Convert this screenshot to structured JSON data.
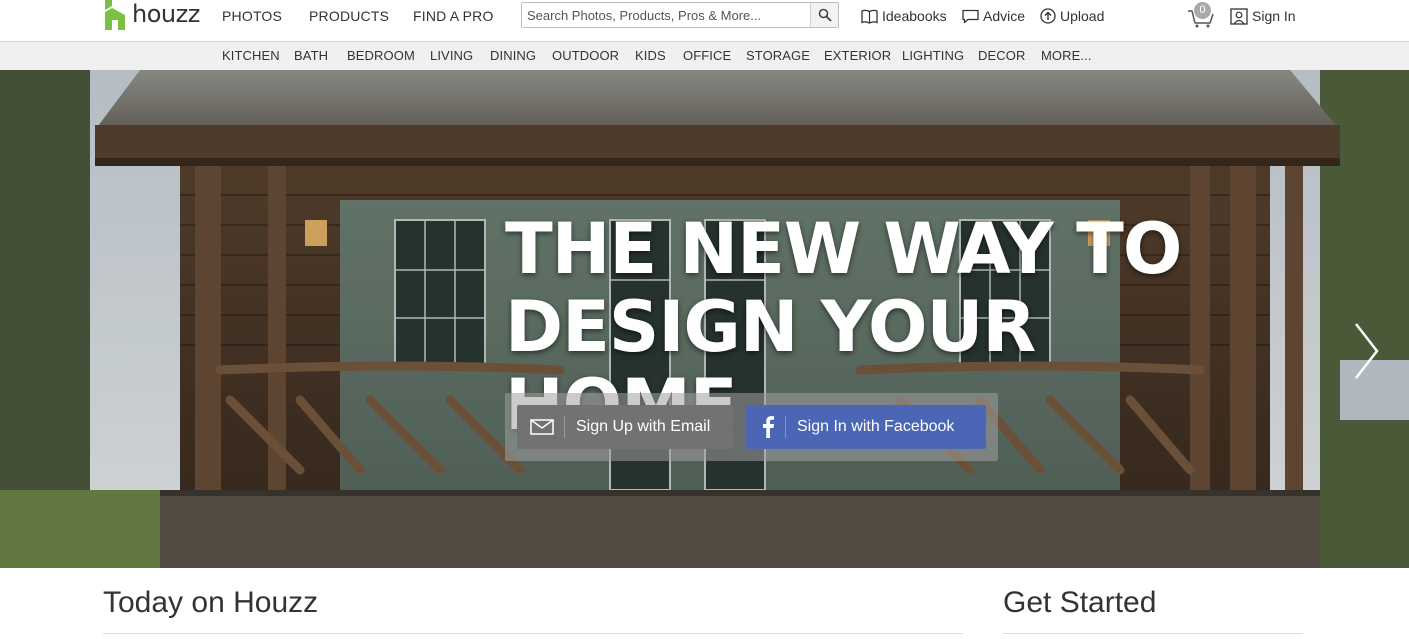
{
  "brand": {
    "name": "houzz",
    "color": "#7ac142"
  },
  "main_nav": [
    {
      "label": "PHOTOS"
    },
    {
      "label": "PRODUCTS"
    },
    {
      "label": "FIND A PRO"
    }
  ],
  "search": {
    "placeholder": "Search Photos, Products, Pros & More...",
    "icon": "search-icon"
  },
  "utility_nav": {
    "ideabooks": {
      "label": "Ideabooks",
      "icon": "book-icon"
    },
    "advice": {
      "label": "Advice",
      "icon": "speech-bubble-icon"
    },
    "upload": {
      "label": "Upload",
      "icon": "upload-icon"
    },
    "cart": {
      "count": "0",
      "icon": "cart-icon"
    },
    "signin": {
      "label": "Sign In",
      "icon": "user-icon"
    }
  },
  "sub_nav": [
    {
      "label": "KITCHEN"
    },
    {
      "label": "BATH"
    },
    {
      "label": "BEDROOM"
    },
    {
      "label": "LIVING"
    },
    {
      "label": "DINING"
    },
    {
      "label": "OUTDOOR"
    },
    {
      "label": "KIDS"
    },
    {
      "label": "OFFICE"
    },
    {
      "label": "STORAGE"
    },
    {
      "label": "EXTERIOR"
    },
    {
      "label": "LIGHTING"
    },
    {
      "label": "DECOR"
    },
    {
      "label": "MORE..."
    }
  ],
  "hero": {
    "headline_line1": "THE NEW WAY TO",
    "headline_line2": "DESIGN YOUR HOME",
    "email_button": {
      "label": "Sign Up with Email",
      "icon": "envelope-icon"
    },
    "facebook_button": {
      "label": "Sign In with Facebook",
      "icon": "facebook-icon",
      "color": "#4a66b5"
    },
    "next_icon": "chevron-right-icon"
  },
  "sections": {
    "today": {
      "title": "Today on Houzz"
    },
    "get_started": {
      "title": "Get Started"
    }
  }
}
